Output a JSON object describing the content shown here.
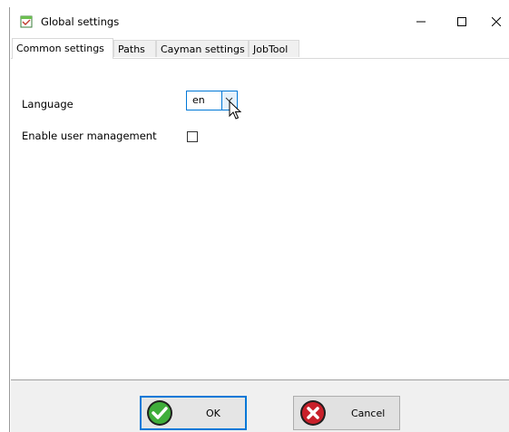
{
  "window": {
    "title": "Global settings",
    "app_icon": "settings-app-icon",
    "controls": {
      "minimize": "minimize-icon",
      "maximize": "maximize-icon",
      "close": "close-icon"
    }
  },
  "tabs": [
    {
      "label": "Common settings",
      "active": true
    },
    {
      "label": "Paths",
      "active": false
    },
    {
      "label": "Cayman settings",
      "active": false
    },
    {
      "label": "JobTool",
      "active": false
    }
  ],
  "form": {
    "language_label": "Language",
    "language_value": "en",
    "user_management_label": "Enable user management",
    "user_management_checked": false
  },
  "buttons": {
    "ok_label": "OK",
    "cancel_label": "Cancel"
  },
  "colors": {
    "accent": "#0078d7",
    "ok_green": "#2e9e34",
    "cancel_red": "#c81c1c"
  }
}
